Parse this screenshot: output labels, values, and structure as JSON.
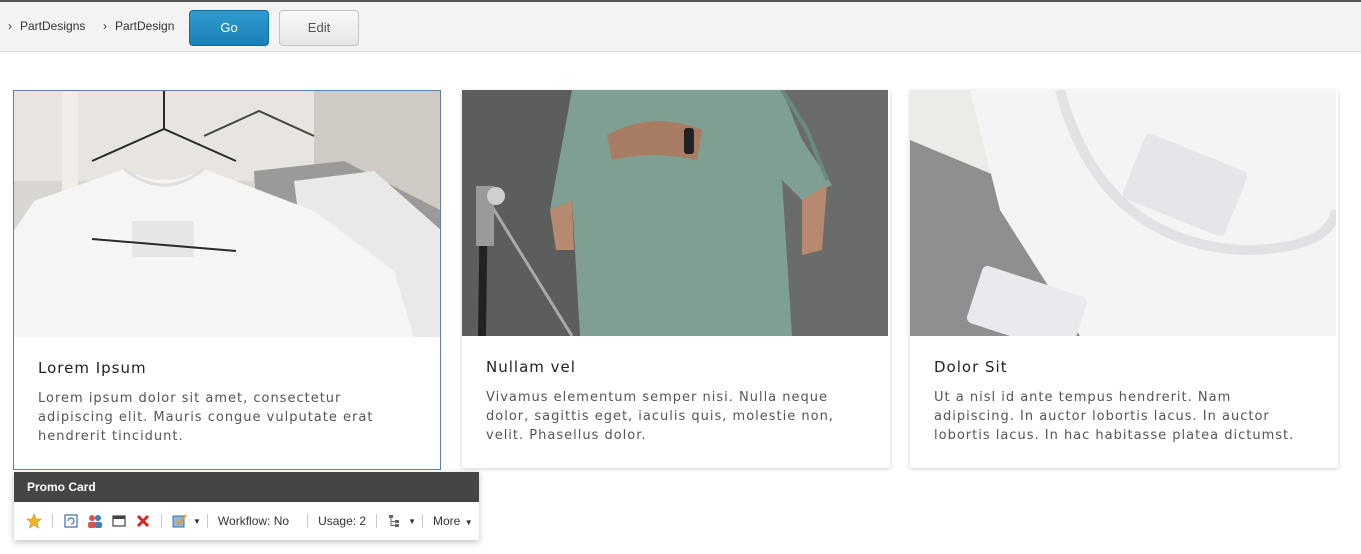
{
  "breadcrumb": {
    "items": [
      {
        "label": "PartDesigns"
      },
      {
        "label": "PartDesign"
      }
    ]
  },
  "actions": {
    "go_label": "Go",
    "edit_label": "Edit"
  },
  "cards": [
    {
      "title": "Lorem Ipsum",
      "text": "Lorem ipsum dolor sit amet, consectetur adipiscing elit. Mauris congue vulputate erat hendrerit tincidunt.",
      "image": "white-tshirts-on-hangers"
    },
    {
      "title": "Nullam vel",
      "text": "Vivamus elementum semper nisi. Nulla neque dolor, sagittis eget, iaculis quis, molestie non, velit. Phasellus dolor.",
      "image": "person-in-green-tshirt"
    },
    {
      "title": "Dolor Sit",
      "text": "Ut a nisl id ante tempus hendrerit. Nam adipiscing. In auctor lobortis lacus. In auctor lobortis lacus. In hac habitasse platea dictumst.",
      "image": "folded-tshirts-closeup"
    }
  ],
  "component_toolbar": {
    "title": "Promo Card",
    "workflow_label": "Workflow: No",
    "usage_label": "Usage: 2",
    "more_label": "More",
    "icons": [
      "star-icon",
      "refresh-icon",
      "users-icon",
      "window-icon",
      "delete-icon",
      "checklist-icon",
      "tree-icon"
    ]
  },
  "colors": {
    "go_button": "#1f8ac0",
    "toolbar_header": "#454545",
    "selection_border": "#5d7fa8"
  }
}
